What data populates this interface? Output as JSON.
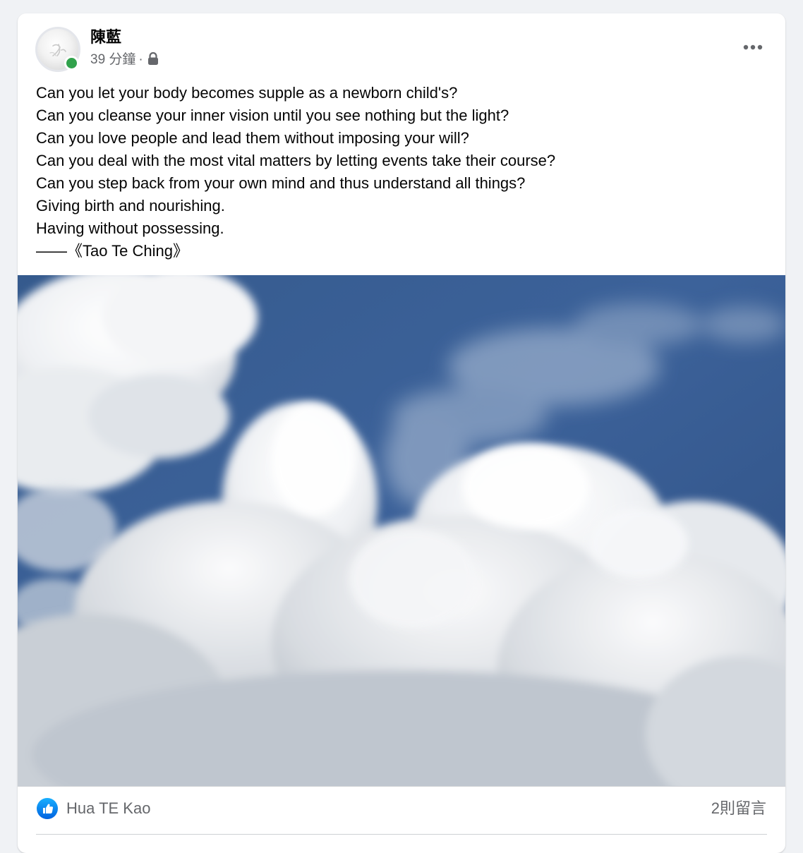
{
  "post": {
    "author": "陳藍",
    "timestamp": "39 分鐘",
    "separator": "·",
    "privacy_icon": "lock-icon",
    "more_icon": "more-horizontal-icon",
    "online": true,
    "text_lines": [
      "Can you let your body becomes supple as a newborn child's?",
      "Can you cleanse your inner vision until you see nothing but the light?",
      "Can you love people and lead them without imposing your will?",
      "Can you deal with the most vital matters by letting events take their course?",
      "Can you step back from your own mind and thus understand all things?",
      "Giving birth and nourishing.",
      "Having without possessing.",
      "——《Tao Te Ching》"
    ],
    "photo": {
      "subject": "sky-with-clouds"
    }
  },
  "footer": {
    "reaction_icon": "like-icon",
    "reactors": "Hua TE Kao",
    "comments_count": "2則留言"
  },
  "colors": {
    "page_bg": "#f0f2f5",
    "card_bg": "#ffffff",
    "primary_text": "#050505",
    "secondary_text": "#65676b",
    "online_green": "#31a24c",
    "like_blue": "#1877f2",
    "sky_blue": "#3a5e93"
  }
}
